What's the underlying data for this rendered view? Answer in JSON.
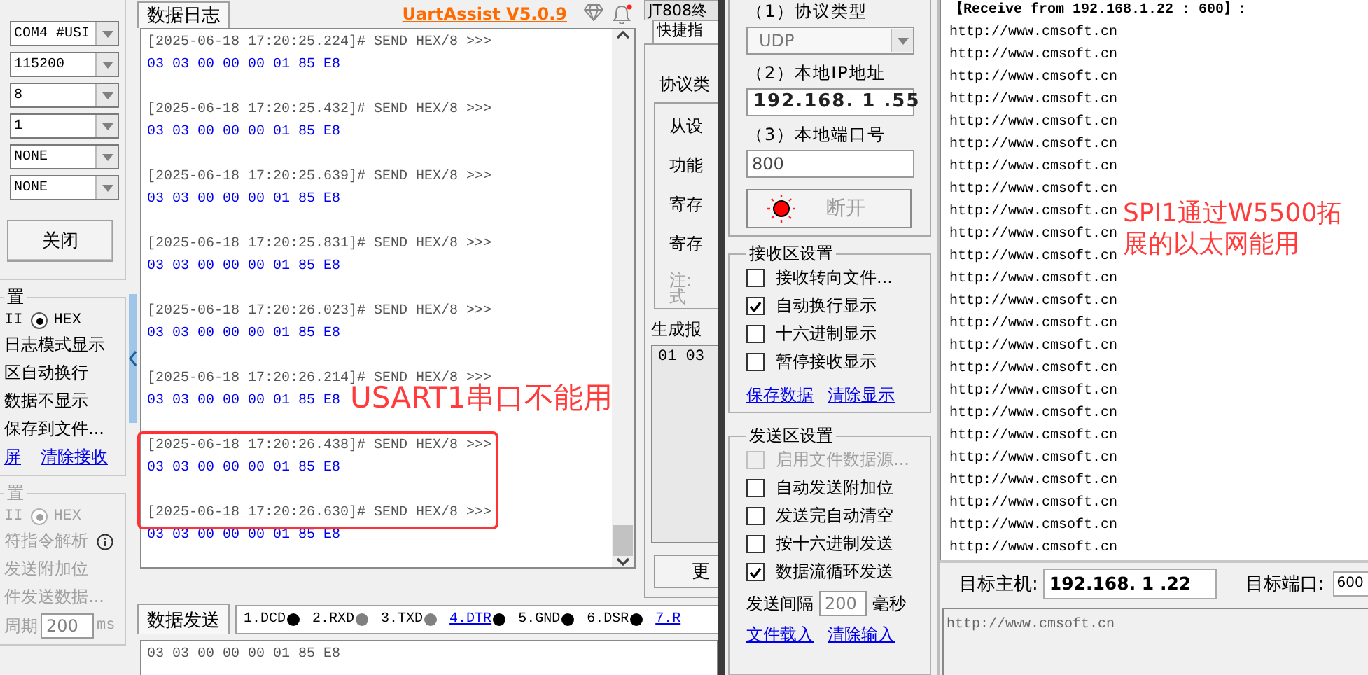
{
  "left_panel": {
    "port_settings": [
      "COM4 #USI",
      "115200",
      "8",
      "1",
      "NONE",
      "NONE"
    ],
    "close_button": "关闭",
    "receive_settings": {
      "title": "置",
      "disabled": false,
      "format_label": "II",
      "hex_option": {
        "label": "HEX",
        "selected": true
      },
      "options": [
        "日志模式显示",
        "区自动换行",
        "数据不显示",
        "保存到文件..."
      ],
      "links": [
        "屏",
        "清除接收"
      ]
    },
    "send_settings": {
      "title": "置",
      "disabled": true,
      "format_label": "II",
      "hex_option": {
        "label": "HEX",
        "selected": true
      },
      "options": [
        "符指令解析",
        "发送附加位",
        "件发送数据..."
      ],
      "period_label": "周期",
      "period_value": "200",
      "period_unit": "ms"
    }
  },
  "log": {
    "tab": "数据日志",
    "app_title": "UartAssist V5.0.9",
    "entries": [
      {
        "header": "[2025-06-18 17:20:25.224]# SEND HEX/8 >>>",
        "data": "03 03 00 00 00 01 85 E8"
      },
      {
        "header": "[2025-06-18 17:20:25.432]# SEND HEX/8 >>>",
        "data": "03 03 00 00 00 01 85 E8"
      },
      {
        "header": "[2025-06-18 17:20:25.639]# SEND HEX/8 >>>",
        "data": "03 03 00 00 00 01 85 E8"
      },
      {
        "header": "[2025-06-18 17:20:25.831]# SEND HEX/8 >>>",
        "data": "03 03 00 00 00 01 85 E8"
      },
      {
        "header": "[2025-06-18 17:20:26.023]# SEND HEX/8 >>>",
        "data": "03 03 00 00 00 01 85 E8"
      },
      {
        "header": "[2025-06-18 17:20:26.214]# SEND HEX/8 >>>",
        "data": "03 03 00 00 00 01 85 E8"
      },
      {
        "header": "[2025-06-18 17:20:26.438]# SEND HEX/8 >>>",
        "data": "03 03 00 00 00 01 85 E8"
      },
      {
        "header": "[2025-06-18 17:20:26.630]# SEND HEX/8 >>>",
        "data": "03 03 00 00 00 01 85 E8"
      }
    ]
  },
  "send": {
    "tab": "数据发送",
    "pins": [
      {
        "label": "1.DCD",
        "kind": "plain",
        "color": "#000000"
      },
      {
        "label": "2.RXD",
        "kind": "plain",
        "color": "#808080"
      },
      {
        "label": "3.TXD",
        "kind": "plain",
        "color": "#808080"
      },
      {
        "label": "4.DTR",
        "kind": "link",
        "color": "#000000"
      },
      {
        "label": "5.GND",
        "kind": "plain",
        "color": "#000000"
      },
      {
        "label": "6.DSR",
        "kind": "plain",
        "color": "#000000"
      },
      {
        "label": "7.R",
        "kind": "link"
      }
    ],
    "value": "03 03 00 00 00 01 85 E8"
  },
  "middle_panel": {
    "tabs": [
      {
        "label": "JT808终",
        "selected": false
      },
      {
        "label": "快捷指",
        "selected": true
      }
    ],
    "group_title": "协议类",
    "rows": [
      "从设",
      "功能",
      "寄存",
      "寄存"
    ],
    "note": [
      "注:",
      "式"
    ],
    "output_label": "生成报",
    "output_value": "01 03",
    "button": "更"
  },
  "net": {
    "protocol": {
      "label": "（1）协议类型",
      "value": "UDP"
    },
    "local_ip": {
      "label": "（2）本地IP地址",
      "value": "192.168. 1 .55"
    },
    "local_port": {
      "label": "（3）本地端口号",
      "value": "800"
    },
    "connect_button": "断开",
    "receive_settings": {
      "title": "接收区设置",
      "options": [
        {
          "label": "接收转向文件...",
          "checked": false,
          "disabled": false
        },
        {
          "label": "自动换行显示",
          "checked": true,
          "disabled": false
        },
        {
          "label": "十六进制显示",
          "checked": false,
          "disabled": false
        },
        {
          "label": "暂停接收显示",
          "checked": false,
          "disabled": false
        }
      ],
      "links": [
        "保存数据",
        "清除显示"
      ]
    },
    "send_settings": {
      "title": "发送区设置",
      "options": [
        {
          "label": "启用文件数据源...",
          "checked": false,
          "disabled": true
        },
        {
          "label": "自动发送附加位",
          "checked": false,
          "disabled": false
        },
        {
          "label": "发送完自动清空",
          "checked": false,
          "disabled": false
        },
        {
          "label": "按十六进制发送",
          "checked": false,
          "disabled": false
        },
        {
          "label": "数据流循环发送",
          "checked": true,
          "disabled": false
        }
      ],
      "interval_label": "发送间隔",
      "interval_value": "200",
      "interval_unit": "毫秒",
      "links": [
        "文件载入",
        "清除输入"
      ]
    },
    "receive_header": "【Receive from 192.168.1.22 : 600】:",
    "received_lines": [
      "http://www.cmsoft.cn",
      "http://www.cmsoft.cn",
      "http://www.cmsoft.cn",
      "http://www.cmsoft.cn",
      "http://www.cmsoft.cn",
      "http://www.cmsoft.cn",
      "http://www.cmsoft.cn",
      "http://www.cmsoft.cn",
      "http://www.cmsoft.cn",
      "http://www.cmsoft.cn",
      "http://www.cmsoft.cn",
      "http://www.cmsoft.cn",
      "http://www.cmsoft.cn",
      "http://www.cmsoft.cn",
      "http://www.cmsoft.cn",
      "http://www.cmsoft.cn",
      "http://www.cmsoft.cn",
      "http://www.cmsoft.cn",
      "http://www.cmsoft.cn",
      "http://www.cmsoft.cn",
      "http://www.cmsoft.cn",
      "http://www.cmsoft.cn",
      "http://www.cmsoft.cn",
      "http://www.cmsoft.cn"
    ],
    "target_host": {
      "label": "目标主机:",
      "value": "192.168. 1 .22"
    },
    "target_port": {
      "label": "目标端口:",
      "value": "600"
    },
    "send_text": "http://www.cmsoft.cn"
  },
  "annotations": [
    {
      "text": "USART1串口不能用"
    },
    {
      "text": "SPI1通过W5500拓展的以太网能用"
    }
  ]
}
